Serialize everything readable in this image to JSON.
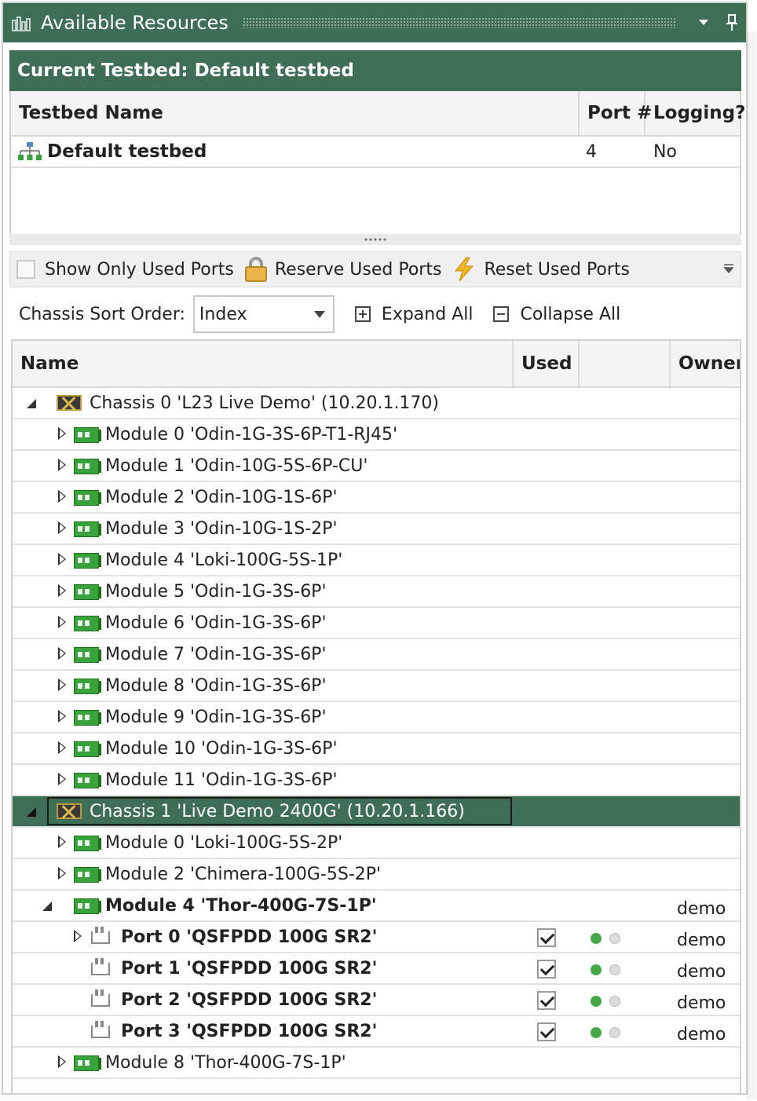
{
  "panel": {
    "title": "Available Resources",
    "menu_icon": "chevron-down-icon",
    "pin_icon": "pin-icon"
  },
  "current_testbed": {
    "label": "Current Testbed:",
    "name": "Default testbed"
  },
  "testbed_table": {
    "columns": [
      "Testbed Name",
      "Port #",
      "Logging?"
    ],
    "rows": [
      {
        "name": "Default testbed",
        "ports": "4",
        "logging": "No",
        "icon": "network-icon"
      }
    ]
  },
  "toolbar": {
    "show_only_used_ports": "Show Only Used Ports",
    "show_only_used_checked": false,
    "reserve_used_ports": "Reserve Used Ports",
    "reset_used_ports": "Reset Used Ports"
  },
  "sort": {
    "label": "Chassis Sort Order:",
    "value": "Index",
    "expand_all": "Expand All",
    "collapse_all": "Collapse All"
  },
  "tree": {
    "columns": [
      "Name",
      "Used",
      "",
      "Owner"
    ],
    "rows": [
      {
        "level": 0,
        "type": "chassis",
        "expander": "open",
        "label": "Chassis 0 'L23 Live Demo' (10.20.1.170)"
      },
      {
        "level": 1,
        "type": "module",
        "expander": "collapsed",
        "label": "Module 0 'Odin-1G-3S-6P-T1-RJ45'"
      },
      {
        "level": 1,
        "type": "module",
        "expander": "collapsed",
        "label": "Module 1 'Odin-10G-5S-6P-CU'"
      },
      {
        "level": 1,
        "type": "module",
        "expander": "collapsed",
        "label": "Module 2 'Odin-10G-1S-6P'"
      },
      {
        "level": 1,
        "type": "module",
        "expander": "collapsed",
        "label": "Module 3 'Odin-10G-1S-2P'"
      },
      {
        "level": 1,
        "type": "module",
        "expander": "collapsed",
        "label": "Module 4 'Loki-100G-5S-1P'"
      },
      {
        "level": 1,
        "type": "module",
        "expander": "collapsed",
        "label": "Module 5 'Odin-1G-3S-6P'"
      },
      {
        "level": 1,
        "type": "module",
        "expander": "collapsed",
        "label": "Module 6 'Odin-1G-3S-6P'"
      },
      {
        "level": 1,
        "type": "module",
        "expander": "collapsed",
        "label": "Module 7 'Odin-1G-3S-6P'"
      },
      {
        "level": 1,
        "type": "module",
        "expander": "collapsed",
        "label": "Module 8 'Odin-1G-3S-6P'"
      },
      {
        "level": 1,
        "type": "module",
        "expander": "collapsed",
        "label": "Module 9 'Odin-1G-3S-6P'"
      },
      {
        "level": 1,
        "type": "module",
        "expander": "collapsed",
        "label": "Module 10 'Odin-1G-3S-6P'"
      },
      {
        "level": 1,
        "type": "module",
        "expander": "collapsed",
        "label": "Module 11 'Odin-1G-3S-6P'"
      },
      {
        "level": 0,
        "type": "chassis",
        "expander": "open",
        "label": "Chassis 1 'Live Demo 2400G' (10.20.1.166)",
        "selected": true
      },
      {
        "level": 1,
        "type": "module",
        "expander": "collapsed",
        "label": "Module 0 'Loki-100G-5S-2P'"
      },
      {
        "level": 1,
        "type": "module",
        "expander": "collapsed",
        "label": "Module 2 'Chimera-100G-5S-2P'"
      },
      {
        "level": 1,
        "type": "module",
        "expander": "open",
        "label": "Module 4 'Thor-400G-7S-1P'",
        "bold": true,
        "owner": "demo"
      },
      {
        "level": 2,
        "type": "port",
        "expander": "collapsed",
        "label": "Port 0 'QSFPDD 100G SR2'",
        "bold": true,
        "used": true,
        "owner": "demo"
      },
      {
        "level": 2,
        "type": "port",
        "expander": "none",
        "label": "Port 1 'QSFPDD 100G SR2'",
        "bold": true,
        "used": true,
        "owner": "demo"
      },
      {
        "level": 2,
        "type": "port",
        "expander": "none",
        "label": "Port 2 'QSFPDD 100G SR2'",
        "bold": true,
        "used": true,
        "owner": "demo"
      },
      {
        "level": 2,
        "type": "port",
        "expander": "none",
        "label": "Port 3 'QSFPDD 100G SR2'",
        "bold": true,
        "used": true,
        "owner": "demo"
      },
      {
        "level": 1,
        "type": "module",
        "expander": "collapsed",
        "label": "Module 8 'Thor-400G-7S-1P'"
      }
    ]
  },
  "colors": {
    "accent": "#3f6e56",
    "status_green": "#46a746",
    "status_grey": "#dcdcdc"
  }
}
